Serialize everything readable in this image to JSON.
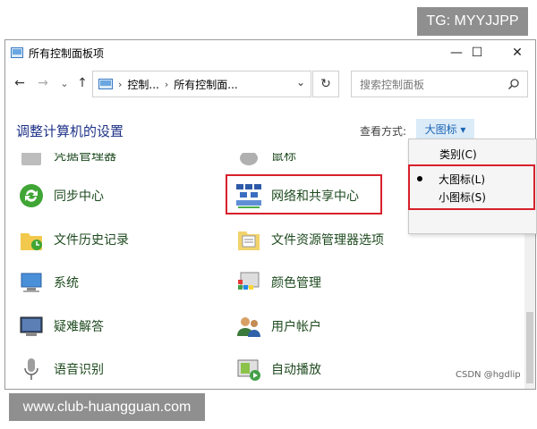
{
  "watermark_top": "TG: MYYJJPP",
  "watermark_bottom": "www.club-huangguan.com",
  "csdn_credit": "CSDN @hgdlip",
  "window": {
    "title": "所有控制面板项",
    "buttons": {
      "minimize": "—",
      "maximize": "☐",
      "close": "✕"
    }
  },
  "nav": {
    "back": "←",
    "forward": "→",
    "recent": "⌄",
    "up": "↑",
    "breadcrumb": [
      "控制...",
      "所有控制面..."
    ],
    "refresh": "↻",
    "search_placeholder": "搜索控制面板"
  },
  "header": {
    "title": "调整计算机的设置",
    "view_label": "查看方式:",
    "view_value": "大图标 ▾"
  },
  "dropdown": {
    "options": [
      "类别(C)",
      "大图标(L)",
      "小图标(S)"
    ],
    "selected": "大图标(L)"
  },
  "items": [
    {
      "label": "凭据管理器",
      "icon": "credential-icon"
    },
    {
      "label": "鼠标",
      "icon": "mouse-icon"
    },
    {
      "label": "同步中心",
      "icon": "sync-icon"
    },
    {
      "label": "网络和共享中心",
      "icon": "network-icon"
    },
    {
      "label": "文件历史记录",
      "icon": "file-history-icon"
    },
    {
      "label": "文件资源管理器选项",
      "icon": "folder-options-icon"
    },
    {
      "label": "系统",
      "icon": "system-icon"
    },
    {
      "label": "颜色管理",
      "icon": "color-management-icon"
    },
    {
      "label": "疑难解答",
      "icon": "troubleshoot-icon"
    },
    {
      "label": "用户帐户",
      "icon": "user-accounts-icon"
    },
    {
      "label": "语音识别",
      "icon": "microphone-icon"
    },
    {
      "label": "自动播放",
      "icon": "autoplay-icon"
    }
  ]
}
